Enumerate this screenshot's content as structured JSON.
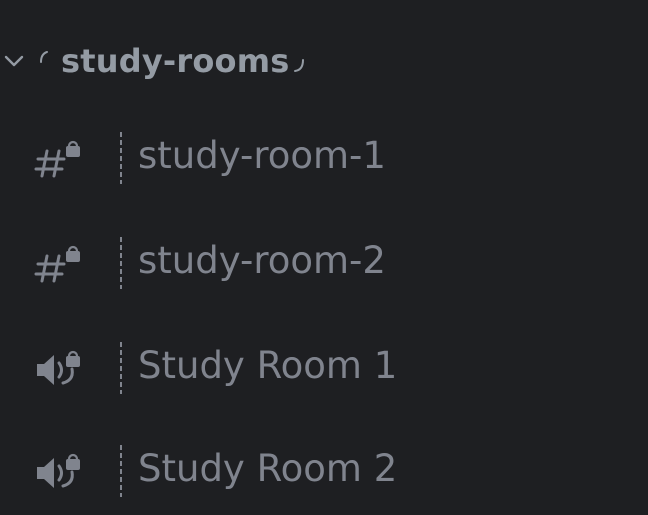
{
  "category": {
    "name": "study-rooms",
    "icons": {
      "toggle": "chevron-down-icon",
      "left_decoration": "arc-left-icon",
      "right_decoration": "arc-right-icon"
    }
  },
  "channels": [
    {
      "label": "study-room-1",
      "type": "text",
      "icon": "locked-text-channel-icon"
    },
    {
      "label": "study-room-2",
      "type": "text",
      "icon": "locked-text-channel-icon"
    },
    {
      "label": "Study Room 1",
      "type": "voice",
      "icon": "locked-voice-channel-icon"
    },
    {
      "label": "Study Room 2",
      "type": "voice",
      "icon": "locked-voice-channel-icon"
    }
  ],
  "colors": {
    "background": "#1e1f22",
    "category_text": "#949ba4",
    "channel_text": "#80848e"
  }
}
